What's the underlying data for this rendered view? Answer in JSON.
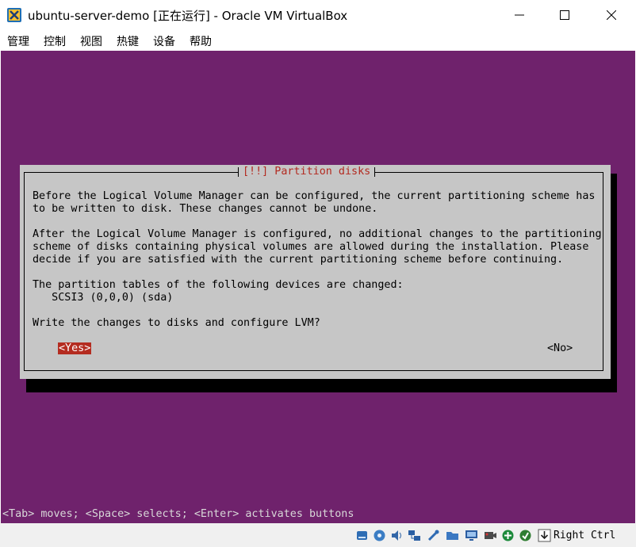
{
  "window": {
    "title": "ubuntu-server-demo [正在运行] - Oracle VM VirtualBox",
    "controls": [
      "minimize",
      "maximize",
      "close"
    ]
  },
  "menu": {
    "items": [
      "管理",
      "控制",
      "视图",
      "热键",
      "设备",
      "帮助"
    ]
  },
  "dialog": {
    "title": "[!!] Partition disks",
    "paragraph1": [
      "Before the Logical Volume Manager can be configured, the current partitioning scheme has",
      "to be written to disk. These changes cannot be undone."
    ],
    "paragraph2": [
      "After the Logical Volume Manager is configured, no additional changes to the partitioning",
      "scheme of disks containing physical volumes are allowed during the installation. Please",
      "decide if you are satisfied with the current partitioning scheme before continuing."
    ],
    "paragraph3": [
      "The partition tables of the following devices are changed:",
      "   SCSI3 (0,0,0) (sda)"
    ],
    "question": "Write the changes to disks and configure LVM?",
    "yes_label": "<Yes>",
    "no_label": "<No>"
  },
  "help_line": "<Tab> moves; <Space> selects; <Enter> activates buttons",
  "statusbar": {
    "icons": [
      "hard-disk-icon",
      "optical-disk-icon",
      "audio-icon",
      "network-icon",
      "usb-icon",
      "shared-folders-icon",
      "display-icon",
      "video-capture-icon",
      "guest-additions-icon",
      "mouse-integration-icon",
      "arrow-down-icon"
    ],
    "host_key": "Right Ctrl"
  },
  "colors": {
    "console_background": "#6f226c",
    "dialog_background": "#c6c6c6",
    "accent_red": "#b42c20"
  }
}
